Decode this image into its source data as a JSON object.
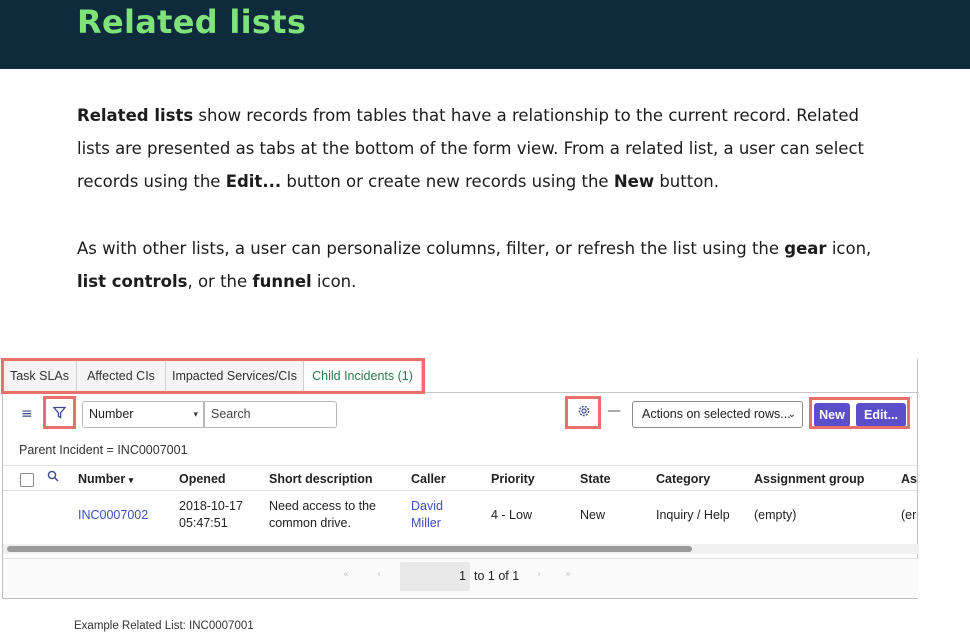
{
  "header": {
    "title": "Related lists"
  },
  "intro": {
    "p1_b1": "Related lists",
    "p1_t1": " show records from tables that have a relationship to the current record. Related lists are presented as tabs at the bottom of the form view. From a related list, a user can select records using the ",
    "p1_b2": "Edit...",
    "p1_t2": " button or create new records using the ",
    "p1_b3": "New",
    "p1_t3": " button.",
    "p2_t1": "As with other lists, a user can personalize columns, filter, or refresh the list using the ",
    "p2_b1": "gear",
    "p2_t2": " icon, ",
    "p2_b2": "list controls",
    "p2_t3": ", or the ",
    "p2_b3": "funnel",
    "p2_t4": " icon."
  },
  "tabs": [
    "Task SLAs",
    "Affected CIs",
    "Impacted Services/CIs",
    "Child Incidents (1)"
  ],
  "toolbar": {
    "field_select": "Number",
    "search_placeholder": "Search",
    "actions_select": "Actions on selected rows...",
    "new_label": "New",
    "edit_label": "Edit..."
  },
  "breadcrumb": "Parent Incident = INC0007001",
  "table": {
    "headers": [
      "Number",
      "Opened",
      "Short description",
      "Caller",
      "Priority",
      "State",
      "Category",
      "Assignment group",
      "As"
    ],
    "sort_indicator": "▾",
    "row": {
      "number": "INC0007002",
      "opened_date": "2018-10-17",
      "opened_time": "05:47:51",
      "desc_line1": "Need access to the",
      "desc_line2": "common drive.",
      "caller_first": "David",
      "caller_last": "Miller",
      "priority": "4 - Low",
      "state": "New",
      "category": "Inquiry / Help",
      "assignment_group": "(empty)",
      "assigned": "(er"
    }
  },
  "pager": {
    "page": "1",
    "range": "to 1 of 1"
  },
  "caption": "Example Related List: INC0007001",
  "colors": {
    "hero_bg": "#0d2b3a",
    "hero_text": "#7fe27a",
    "button": "#5a4fc9",
    "highlight": "#e8716b",
    "link": "#3d4fb8"
  }
}
